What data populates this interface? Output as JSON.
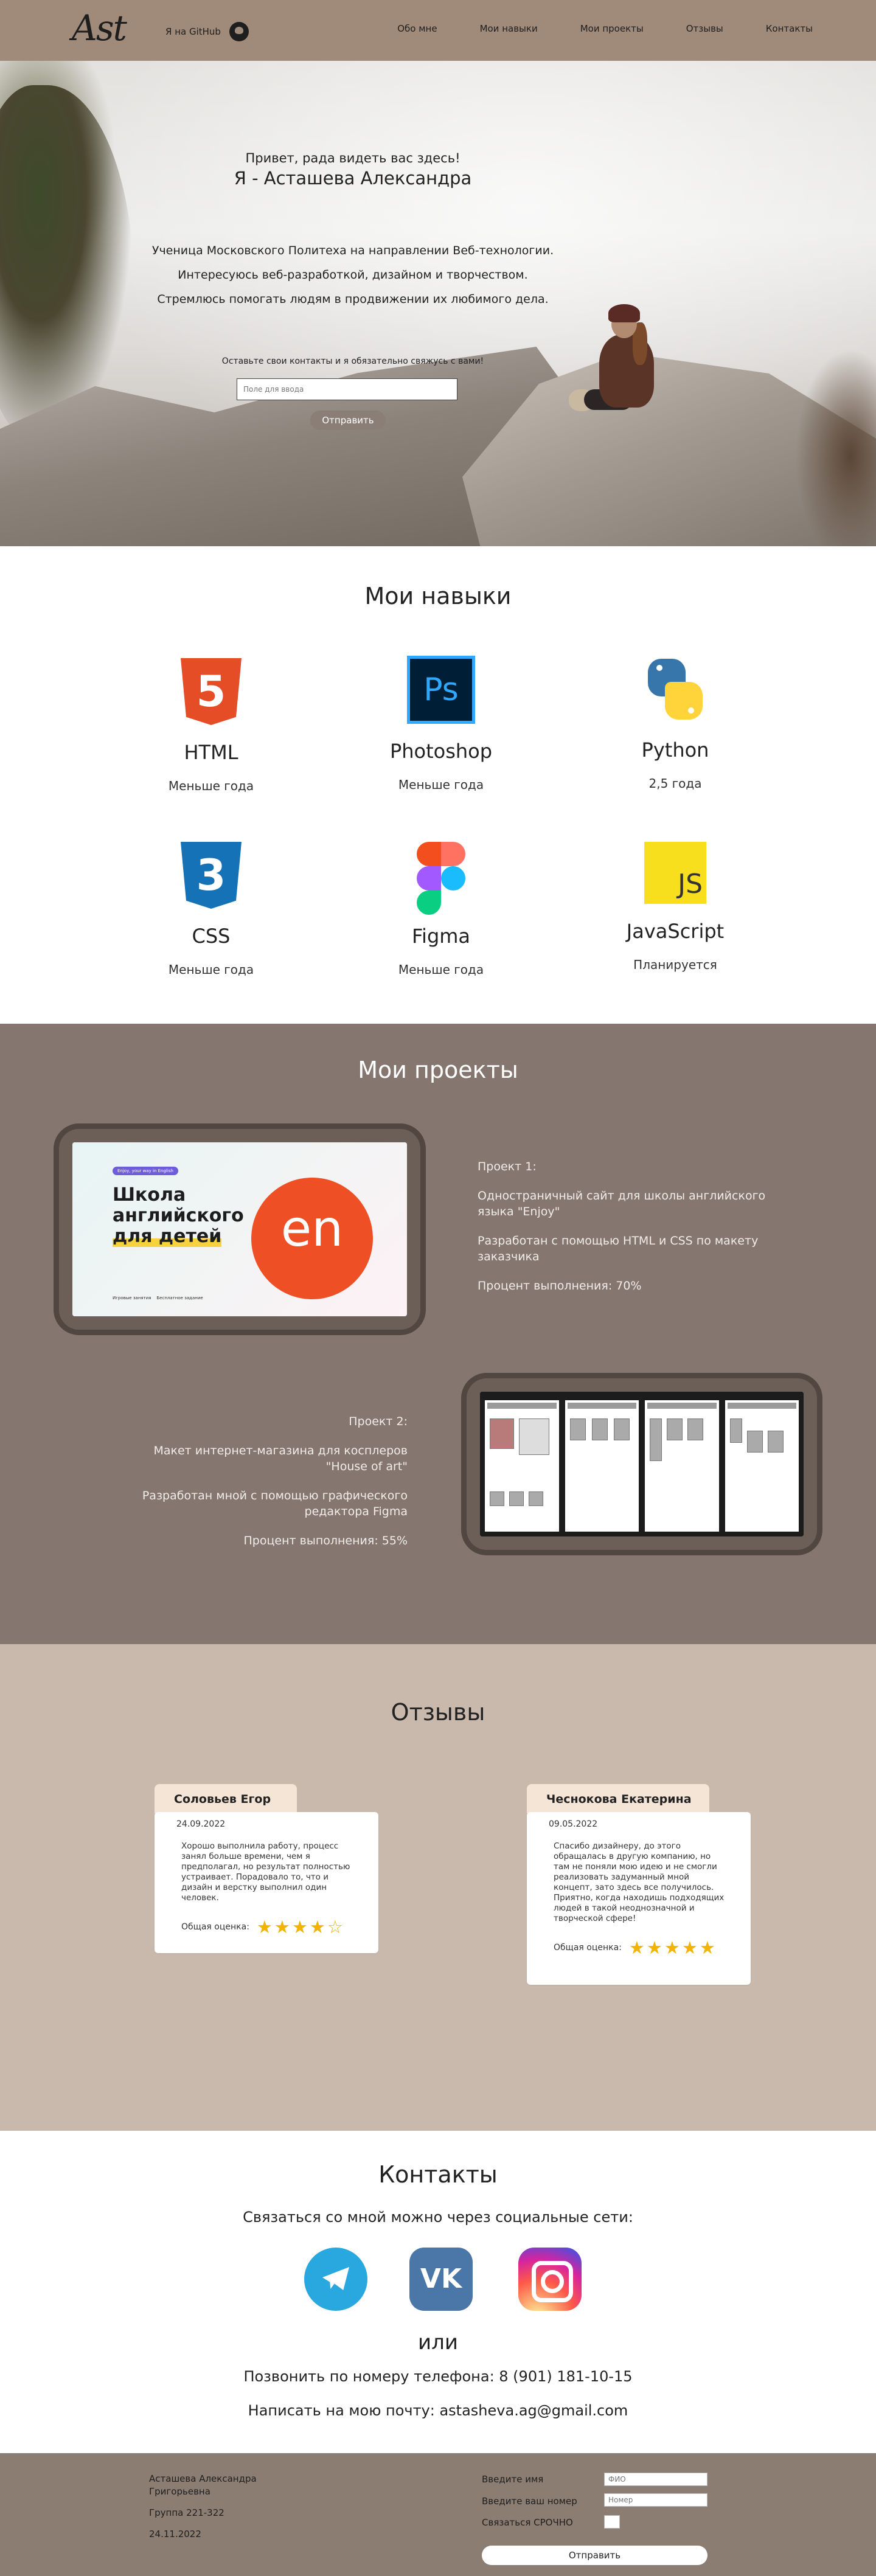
{
  "header": {
    "logo": "Ast",
    "github_label": "Я на GitHub",
    "nav": [
      "Обо мне",
      "Мои навыки",
      "Мои проекты",
      "Отзывы",
      "Контакты"
    ]
  },
  "hero": {
    "greeting": "Привет, рада видеть вас здесь!",
    "name": "Я - Асташева Александра",
    "about": [
      "Ученица Московского Политеха на направлении Веб-технологии.",
      "Интересуюсь веб-разработкой, дизайном и творчеством.",
      "Стремлюсь помогать людям в продвижении их любимого дела."
    ],
    "cta": "Оставьте свои контакты и я обязательно свяжусь с вами!",
    "input_placeholder": "Поле для ввода",
    "send_label": "Отправить"
  },
  "skills": {
    "title": "Мои навыки",
    "items": [
      {
        "name": "HTML",
        "level": "Меньше года",
        "icon": "html5-icon"
      },
      {
        "name": "Photoshop",
        "level": "Меньше года",
        "icon": "photoshop-icon"
      },
      {
        "name": "Python",
        "level": "2,5 года",
        "icon": "python-icon"
      },
      {
        "name": "CSS",
        "level": "Меньше года",
        "icon": "css3-icon"
      },
      {
        "name": "Figma",
        "level": "Меньше года",
        "icon": "figma-icon"
      },
      {
        "name": "JavaScript",
        "level": "Планируется",
        "icon": "javascript-icon"
      }
    ],
    "ps_text": "Ps",
    "js_text": "JS"
  },
  "projects": {
    "title": "Мои проекты",
    "items": [
      {
        "label": "Проект 1:",
        "desc": "Одностраничный сайт для школы английского языка \"Enjoy\"",
        "tech": "Разработан с помощью HTML и CSS по макету заказчика",
        "progress": "Процент выполнения: 70%"
      },
      {
        "label": "Проект 2:",
        "desc": "Макет интернет-магазина для косплеров \"House of art\"",
        "tech": "Разработан мной с помощью графического редактора Figma",
        "progress": "Процент выполнения: 55%"
      }
    ],
    "enjoy": {
      "badge": "Enjoy, your way in English",
      "headline_1": "Школа",
      "headline_2": "английского",
      "headline_3": "для детей",
      "logo_text": "en",
      "stat_1": "Игровые занятия",
      "stat_2": "Бесплатное задание"
    }
  },
  "reviews": {
    "title": "Отзывы",
    "items": [
      {
        "author": "Соловьев Егор",
        "date": "24.09.2022",
        "text": "Хорошо выполнила работу, процесс занял больше времени, чем я предполагал, но результат полностью устраивает. Порадовало то, что и дизайн и верстку выполнил один человек.",
        "score_label": "Общая оценка:",
        "stars": "★★★★☆",
        "rating": 4
      },
      {
        "author": "Чеснокова Екатерина",
        "date": "09.05.2022",
        "text": "Спасибо дизайнеру, до этого обращалась в другую компанию, но там не поняли мою идею и не смогли реализовать задуманный мной концепт, зато здесь все получилось. Приятно, когда находишь подходящих людей в такой неоднозначной и творческой сфере!",
        "score_label": "Общая оценка:",
        "stars": "★★★★★",
        "rating": 5
      }
    ]
  },
  "contacts": {
    "title": "Контакты",
    "social_caption": "Связаться со мной можно через социальные сети:",
    "or": "или",
    "phone": "Позвонить по номеру телефона: 8 (901) 181-10-15",
    "email": "Написать на мою почту: astasheva.ag@gmail.com",
    "vk_text": "VK"
  },
  "footer": {
    "name": "Асташева Александра Григорьевна",
    "group": "Группа 221-322",
    "date": "24.11.2022",
    "name_label": "Введите имя",
    "name_placeholder": "ФИО",
    "phone_label": "Введите ваш номер",
    "phone_placeholder": "Номер",
    "urgent_label": "Связаться СРОЧНО",
    "submit_label": "Отправить"
  }
}
